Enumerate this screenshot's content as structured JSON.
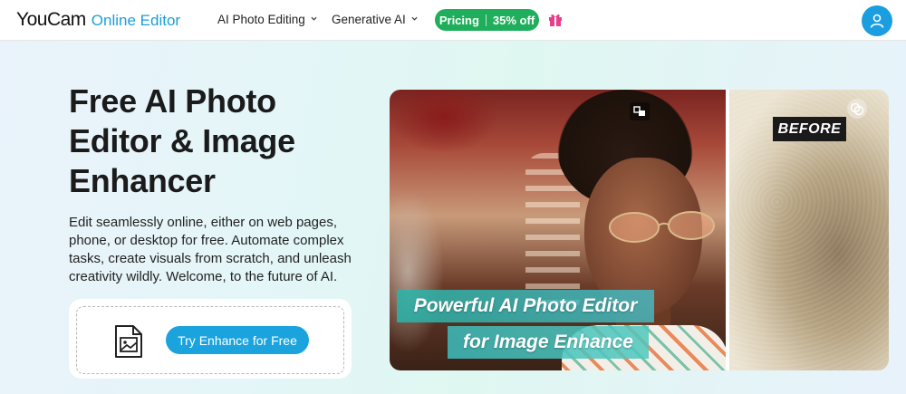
{
  "header": {
    "logo_main": "YouCam",
    "logo_sub": "Online Editor",
    "nav": [
      {
        "label": "AI Photo Editing"
      },
      {
        "label": "Generative AI"
      }
    ],
    "pricing": {
      "label": "Pricing",
      "discount": "35% off"
    },
    "icons": {
      "gift": "gift-icon",
      "avatar": "user-icon"
    }
  },
  "hero": {
    "title": "Free AI Photo Editor & Image Enhancer",
    "description": "Edit seamlessly online, either on web pages, phone, or desktop for free. Automate complex tasks, create visuals from scratch, and unleash creativity wildly. Welcome, to the future of AI.",
    "cta_label": "Try Enhance for Free",
    "upload_icon": "image-upload-icon"
  },
  "showcase": {
    "before_label": "BEFORE",
    "banner_line1": "Powerful AI Photo Editor",
    "banner_line2": "for Image Enhance"
  },
  "colors": {
    "brand_blue": "#1ba3dd",
    "pricing_green": "#1fae5b",
    "gift_pink": "#e83e8c"
  }
}
